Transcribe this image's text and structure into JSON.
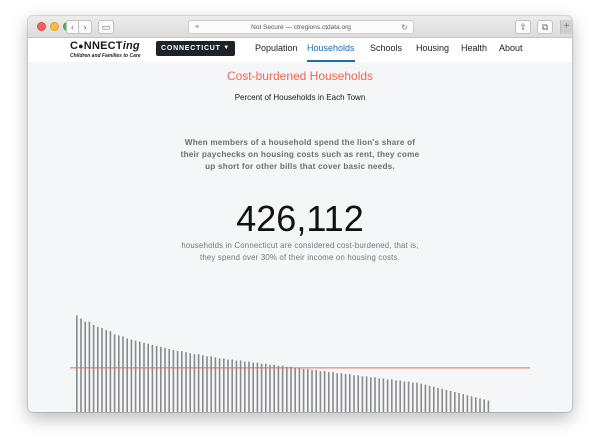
{
  "browser": {
    "url_text": "Not Secure — ctregions.ctdata.org"
  },
  "logo": {
    "main": "C",
    "main_rest": "NNECT",
    "main_ing": "ing",
    "tagline": "Children and Families to Care"
  },
  "nav": {
    "state_selector": "CONNECTICUT",
    "links": [
      "Population",
      "Households",
      "Schools",
      "Housing",
      "Health",
      "About"
    ],
    "active": "Households"
  },
  "content": {
    "title": "Cost-burdened Households",
    "subtitle": "Percent of Households in Each Town",
    "intro": "When members of a household spend the lion's share of their paychecks on housing costs such as rent, they come up short for other bills that cover basic needs.",
    "big_number": "426,112",
    "detail": "households in Connecticut are considered cost-burdened, that is, they spend over 30% of their income on housing costs."
  },
  "colors": {
    "accent": "#f2654f",
    "active_nav": "#1a6db5",
    "bar": "#8a8a8a",
    "reference_line": "#f2654f"
  },
  "chart_data": {
    "type": "bar",
    "series": [
      {
        "values": [
          92,
          89,
          86,
          86,
          83,
          81,
          80,
          78,
          77,
          74,
          73,
          72,
          70,
          69,
          68,
          67,
          66,
          65,
          64,
          63,
          62,
          61,
          60,
          59,
          58,
          58,
          57,
          56,
          55,
          55,
          54,
          53,
          53,
          52,
          51,
          51,
          50,
          50,
          49,
          49,
          48,
          48,
          47,
          47,
          46,
          46,
          45,
          45,
          44,
          44,
          43,
          43,
          42,
          42,
          41,
          41,
          40,
          40,
          39,
          39,
          38,
          38,
          37,
          37,
          36,
          36,
          35,
          35,
          34,
          34,
          33,
          33,
          32,
          32,
          31,
          31,
          30,
          30,
          29,
          29,
          28,
          28,
          27,
          26,
          25,
          24,
          23,
          22,
          21,
          20,
          19,
          18,
          17,
          16,
          15,
          14,
          13,
          12,
          11
        ]
      }
    ],
    "reference_value": 42,
    "ylim": [
      0,
      100
    ],
    "xlabel": "",
    "ylabel": ""
  }
}
